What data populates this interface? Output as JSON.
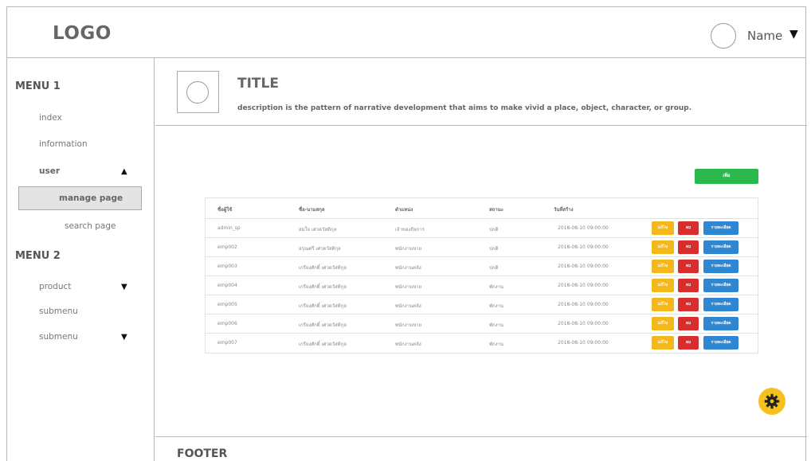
{
  "header": {
    "logo": "LOGO",
    "user_name": "Name",
    "caret": "▼"
  },
  "sidebar": {
    "menu1_title": "MENU 1",
    "index": "index",
    "information": "information",
    "user": "user",
    "user_caret": "▲",
    "manage_page": "manage page",
    "search_page": "search page",
    "menu2_title": "MENU 2",
    "product": "product",
    "product_caret": "▼",
    "submenu1": "submenu",
    "submenu2": "submenu",
    "submenu2_caret": "▼"
  },
  "title_band": {
    "title": "TITLE",
    "description": "description is the pattern of narrative development that aims to make vivid a place, object, character, or group."
  },
  "actions": {
    "add": "เพิ่ม"
  },
  "table": {
    "headers": [
      "ชื่อผู้ใช้",
      "ชื่อ-นามสกุล",
      "ตำแหน่ง",
      "สถานะ",
      "วันที่สร้าง"
    ],
    "rows": [
      {
        "username": "admin_sp",
        "fullname": "สมใจ เศวตวัสติกุล",
        "position": "เจ้าของกิจการ",
        "status": "ปกติ",
        "created": "2018-08-10 09:00:00"
      },
      {
        "username": "emp002",
        "fullname": "อรุณศรี เศวตวัสติกุล",
        "position": "พนักงานขาย",
        "status": "ปกติ",
        "created": "2018-08-10 09:00:00"
      },
      {
        "username": "emp003",
        "fullname": "เกรียงศักดิ์ เศวตวัสติกุล",
        "position": "พนักงานคลัง",
        "status": "ปกติ",
        "created": "2018-08-10 09:00:00"
      },
      {
        "username": "emp004",
        "fullname": "เกรียงศักดิ์ เศวตวัสติกุล",
        "position": "พนักงานขาย",
        "status": "พักงาน",
        "created": "2018-08-10 09:00:00"
      },
      {
        "username": "emp005",
        "fullname": "เกรียงศักดิ์ เศวตวัสติกุล",
        "position": "พนักงานคลัง",
        "status": "พักงาน",
        "created": "2018-08-10 09:00:00"
      },
      {
        "username": "emp006",
        "fullname": "เกรียงศักดิ์ เศวตวัสติกุล",
        "position": "พนักงานขาย",
        "status": "พักงาน",
        "created": "2018-08-10 09:00:00"
      },
      {
        "username": "emp007",
        "fullname": "เกรียงศักดิ์ เศวตวัสติกุล",
        "position": "พนักงานคลัง",
        "status": "พักงาน",
        "created": "2018-08-10 09:00:00"
      }
    ],
    "row_actions": {
      "edit": "แก้ไข",
      "delete": "ลบ",
      "detail": "รายละเอียด"
    }
  },
  "footer": {
    "label": "FOOTER"
  },
  "colors": {
    "add": "#2bb84c",
    "edit": "#f4b81c",
    "delete": "#d92c2c",
    "detail": "#2f86d1",
    "gear_fab": "#f6c11e"
  },
  "icons": {
    "settings_fab": "gear-icon",
    "avatar": "avatar-circle",
    "placeholder": "image-placeholder"
  }
}
